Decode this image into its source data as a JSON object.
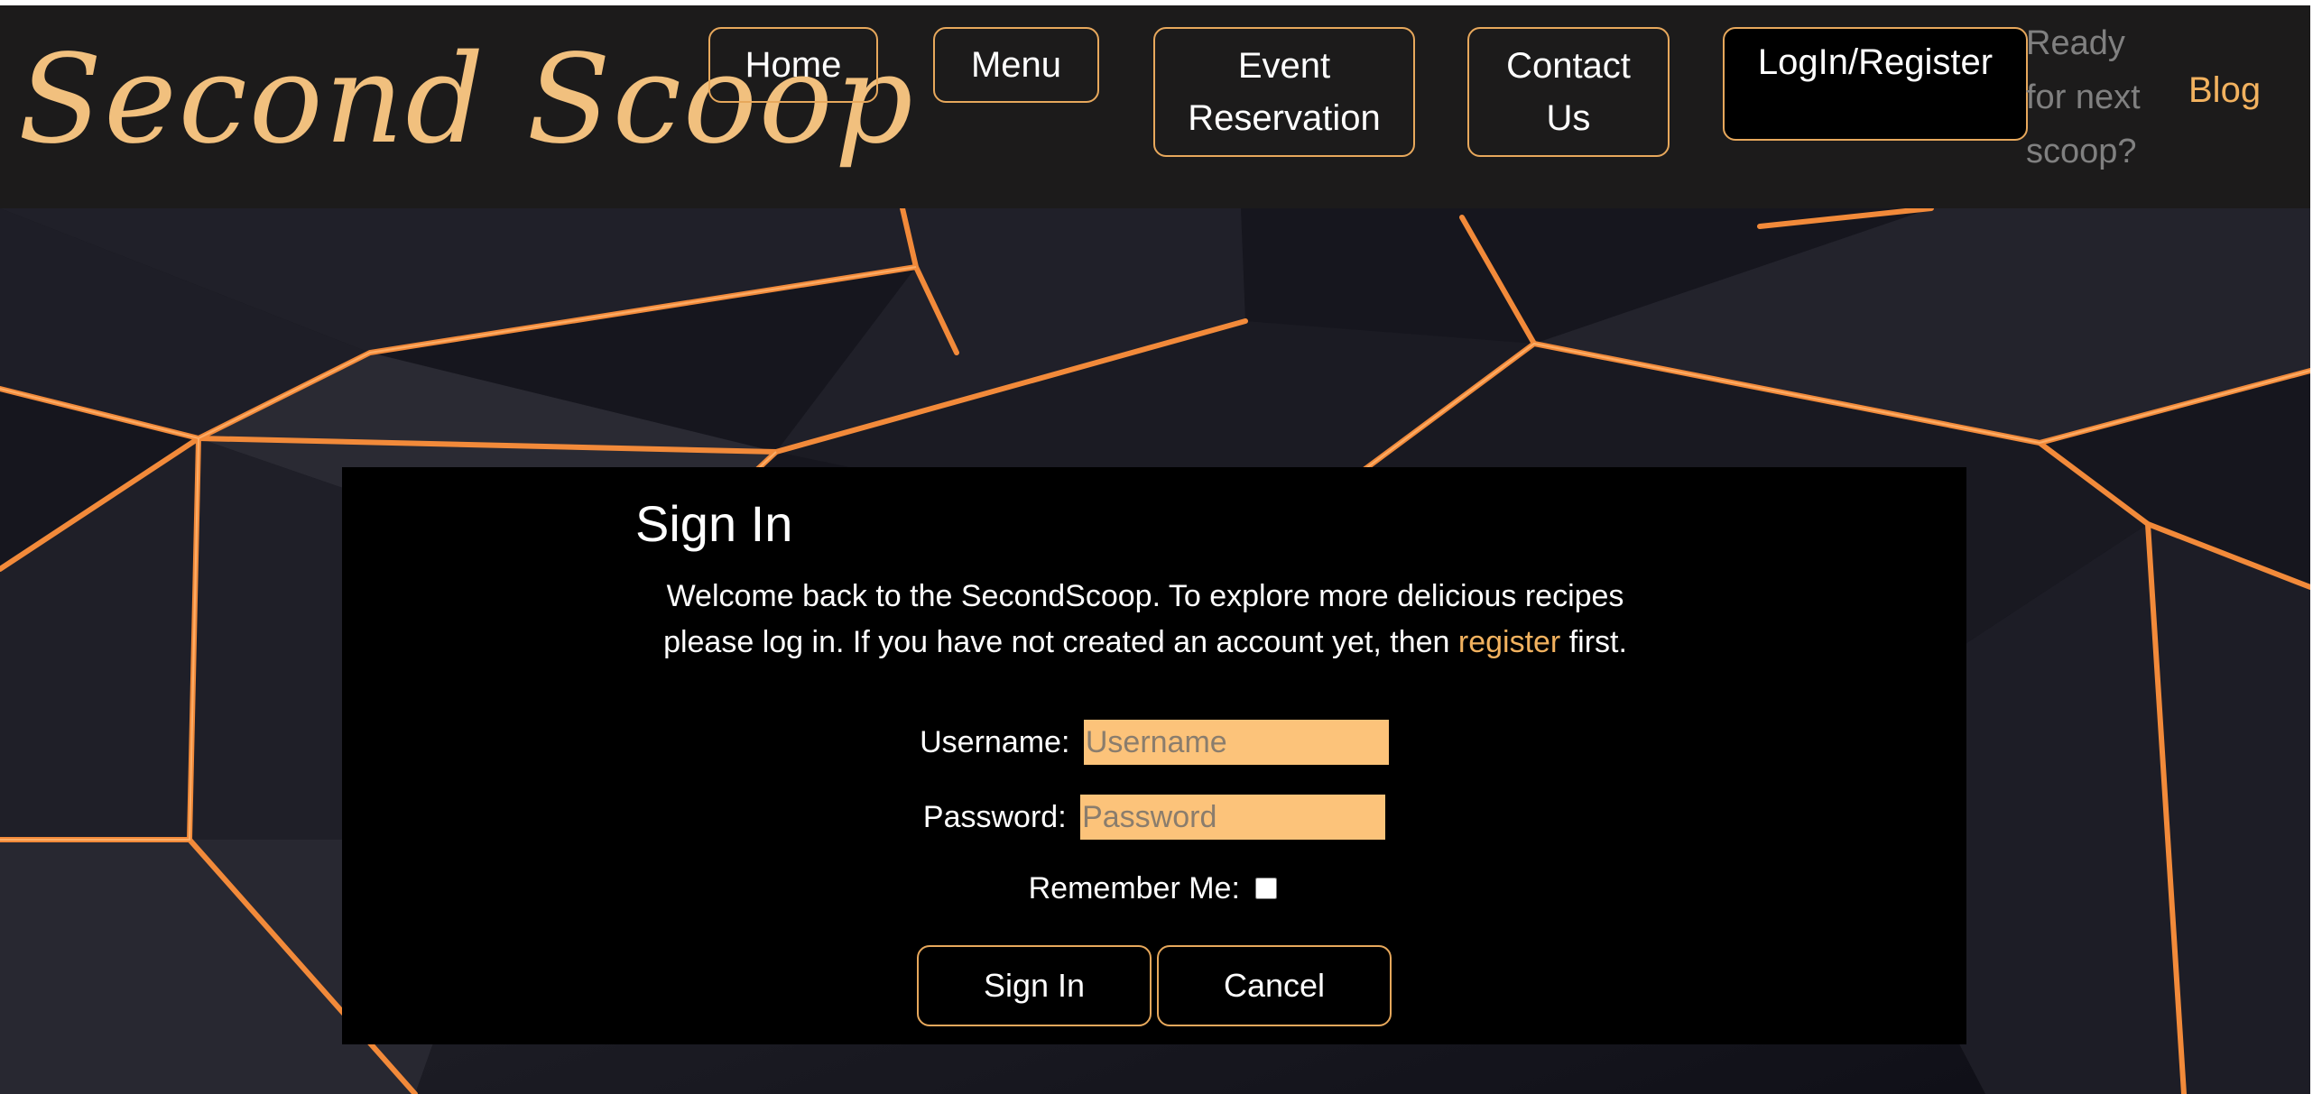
{
  "brand": {
    "logo_text": "Second Scoop"
  },
  "nav": {
    "items": [
      {
        "label": "Home"
      },
      {
        "label": "Menu"
      },
      {
        "label": "Event Reservation"
      },
      {
        "label": "Contact Us"
      },
      {
        "label": "LogIn/Register"
      }
    ],
    "tagline": "Ready for next scoop?",
    "blog_label": "Blog"
  },
  "signin": {
    "title": "Sign In",
    "intro_before": "Welcome back to the SecondScoop. To explore more delicious recipes please log in. If you have not created an account yet, then ",
    "register_link": "register",
    "intro_after": " first.",
    "username_label": "Username:",
    "username_placeholder": "Username",
    "username_value": "",
    "password_label": "Password:",
    "password_placeholder": "Password",
    "password_value": "",
    "remember_label": "Remember Me:",
    "remember_checked": false,
    "signin_button": "Sign In",
    "cancel_button": "Cancel"
  },
  "colors": {
    "accent": "#f2b25f",
    "nav_background": "#1c1b1b",
    "panel_background": "#000000",
    "input_background": "#fcc37a"
  }
}
